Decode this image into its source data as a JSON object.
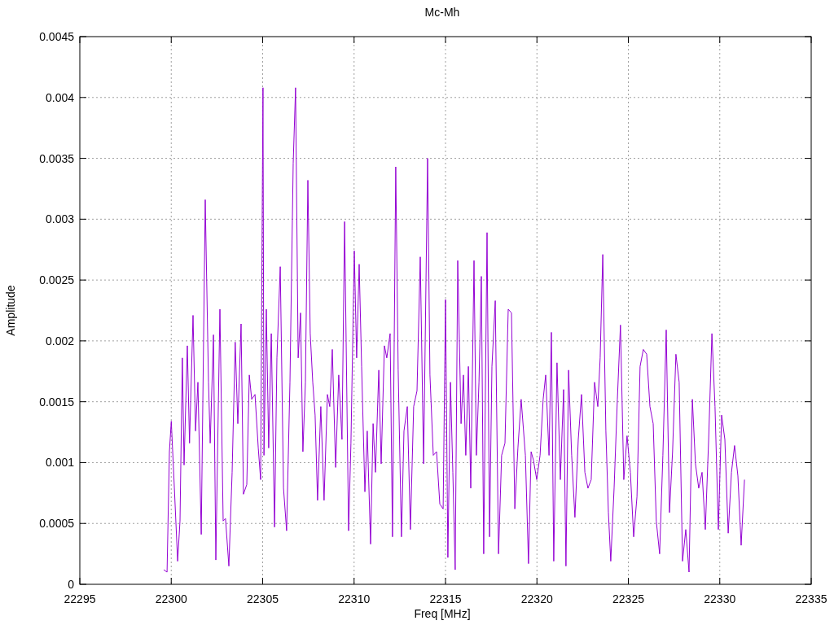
{
  "plot": {
    "chart_data": {
      "type": "line",
      "title": "Mc-Mh",
      "xlabel": "Freq [MHz]",
      "ylabel": "Amplitude",
      "x": [
        22299.59,
        22299.77,
        22299.9,
        22300.0,
        22300.17,
        22300.35,
        22300.48,
        22300.61,
        22300.7,
        22300.88,
        22301.0,
        22301.19,
        22301.33,
        22301.46,
        22301.64,
        22301.86,
        22302.04,
        22302.13,
        22302.31,
        22302.44,
        22302.66,
        22302.84,
        22302.97,
        22303.15,
        22303.33,
        22303.5,
        22303.64,
        22303.82,
        22303.95,
        22304.13,
        22304.27,
        22304.4,
        22304.58,
        22304.76,
        22304.89,
        22305.02,
        22305.07,
        22305.2,
        22305.33,
        22305.47,
        22305.65,
        22305.78,
        22305.96,
        22306.14,
        22306.31,
        22306.49,
        22306.67,
        22306.8,
        22306.94,
        22307.07,
        22307.2,
        22307.34,
        22307.47,
        22307.6,
        22307.74,
        22307.87,
        22308.0,
        22308.18,
        22308.36,
        22308.54,
        22308.67,
        22308.81,
        22308.99,
        22309.16,
        22309.34,
        22309.48,
        22309.7,
        22309.83,
        22310.01,
        22310.14,
        22310.28,
        22310.41,
        22310.59,
        22310.72,
        22310.9,
        22311.04,
        22311.17,
        22311.35,
        22311.48,
        22311.66,
        22311.79,
        22311.97,
        22312.1,
        22312.28,
        22312.41,
        22312.59,
        22312.73,
        22312.91,
        22313.08,
        22313.26,
        22313.44,
        22313.62,
        22313.8,
        22314.02,
        22314.15,
        22314.33,
        22314.51,
        22314.69,
        22314.87,
        22315.0,
        22315.13,
        22315.27,
        22315.4,
        22315.53,
        22315.67,
        22315.85,
        22315.98,
        22316.11,
        22316.25,
        22316.38,
        22316.56,
        22316.69,
        22316.83,
        22316.96,
        22317.09,
        22317.27,
        22317.41,
        22317.54,
        22317.72,
        22317.9,
        22318.07,
        22318.25,
        22318.43,
        22318.61,
        22318.79,
        22318.96,
        22319.14,
        22319.37,
        22319.54,
        22319.68,
        22319.81,
        22319.99,
        22320.17,
        22320.34,
        22320.48,
        22320.66,
        22320.79,
        22320.92,
        22321.1,
        22321.28,
        22321.46,
        22321.59,
        22321.73,
        22321.9,
        22322.08,
        22322.26,
        22322.44,
        22322.62,
        22322.79,
        22322.97,
        22323.15,
        22323.33,
        22323.46,
        22323.6,
        22323.77,
        22323.91,
        22324.04,
        22324.22,
        22324.4,
        22324.57,
        22324.75,
        22324.93,
        22325.11,
        22325.29,
        22325.47,
        22325.64,
        22325.82,
        22326.0,
        22326.18,
        22326.36,
        22326.53,
        22326.71,
        22326.89,
        22327.07,
        22327.25,
        22327.42,
        22327.6,
        22327.78,
        22327.96,
        22328.14,
        22328.32,
        22328.5,
        22328.67,
        22328.85,
        22329.03,
        22329.21,
        22329.39,
        22329.57,
        22329.74,
        22329.92,
        22330.1,
        22330.28,
        22330.46,
        22330.64,
        22330.81,
        22330.99,
        22331.17,
        22331.35
      ],
      "series": [
        {
          "color": "#9400d3",
          "values": [
            0.00012,
            0.0001,
            0.00109,
            0.00134,
            0.00079,
            0.00019,
            0.00052,
            0.00186,
            0.00098,
            0.00196,
            0.00116,
            0.00221,
            0.00126,
            0.00166,
            0.00041,
            0.00316,
            0.00166,
            0.00116,
            0.00205,
            0.0002,
            0.00226,
            0.00052,
            0.00054,
            0.00015,
            0.00092,
            0.00199,
            0.00132,
            0.00214,
            0.00074,
            0.00082,
            0.00172,
            0.00152,
            0.00156,
            0.00112,
            0.00086,
            0.00408,
            0.00106,
            0.00226,
            0.00112,
            0.00206,
            0.00047,
            0.00186,
            0.00261,
            0.00079,
            0.00044,
            0.00166,
            0.00346,
            0.00408,
            0.00186,
            0.00223,
            0.00109,
            0.00166,
            0.00332,
            0.00206,
            0.00166,
            0.00139,
            0.00069,
            0.00146,
            0.00069,
            0.00156,
            0.00146,
            0.00193,
            0.00096,
            0.00172,
            0.00119,
            0.00298,
            0.00044,
            0.00116,
            0.00274,
            0.00186,
            0.00263,
            0.00179,
            0.00076,
            0.00126,
            0.00033,
            0.00132,
            0.00092,
            0.00176,
            0.00099,
            0.00196,
            0.00186,
            0.00206,
            0.00039,
            0.00343,
            0.00176,
            0.00039,
            0.00126,
            0.00146,
            0.00045,
            0.00146,
            0.00159,
            0.00269,
            0.00099,
            0.0035,
            0.00172,
            0.00106,
            0.00109,
            0.00066,
            0.00062,
            0.00234,
            0.00022,
            0.00166,
            0.00092,
            0.00012,
            0.00266,
            0.00132,
            0.00172,
            0.00106,
            0.00179,
            0.00079,
            0.00266,
            0.00106,
            0.00166,
            0.00253,
            0.00025,
            0.00289,
            0.00039,
            0.00179,
            0.00233,
            0.00025,
            0.00106,
            0.00116,
            0.00226,
            0.00223,
            0.00062,
            0.00112,
            0.00152,
            0.00106,
            0.00017,
            0.00109,
            0.00102,
            0.00086,
            0.00106,
            0.00152,
            0.00172,
            0.00106,
            0.00207,
            0.00019,
            0.00182,
            0.00086,
            0.0016,
            0.00015,
            0.00176,
            0.00106,
            0.00055,
            0.00119,
            0.00156,
            0.00092,
            0.00079,
            0.00086,
            0.00166,
            0.00146,
            0.00186,
            0.00271,
            0.00126,
            0.00059,
            0.00019,
            0.00079,
            0.00152,
            0.00213,
            0.00086,
            0.00122,
            0.00092,
            0.00039,
            0.00072,
            0.00179,
            0.00193,
            0.00189,
            0.00146,
            0.00132,
            0.00052,
            0.00025,
            0.00106,
            0.00209,
            0.00059,
            0.00109,
            0.00189,
            0.00166,
            0.00019,
            0.00045,
            0.0001,
            0.00152,
            0.00099,
            0.00079,
            0.00092,
            0.00045,
            0.00119,
            0.00206,
            0.00146,
            0.00045,
            0.00139,
            0.00119,
            0.00042,
            0.00092,
            0.00114,
            0.00089,
            0.00032,
            0.00086
          ]
        }
      ],
      "xlim": [
        22295,
        22335
      ],
      "ylim": [
        0,
        0.0045
      ],
      "xticks": [
        22295,
        22300,
        22305,
        22310,
        22315,
        22320,
        22325,
        22330,
        22335
      ],
      "grid": true,
      "yticks": [
        0,
        0.0005,
        0.001,
        0.0015,
        0.002,
        0.0025,
        0.003,
        0.0035,
        0.004,
        0.0045
      ]
    }
  }
}
